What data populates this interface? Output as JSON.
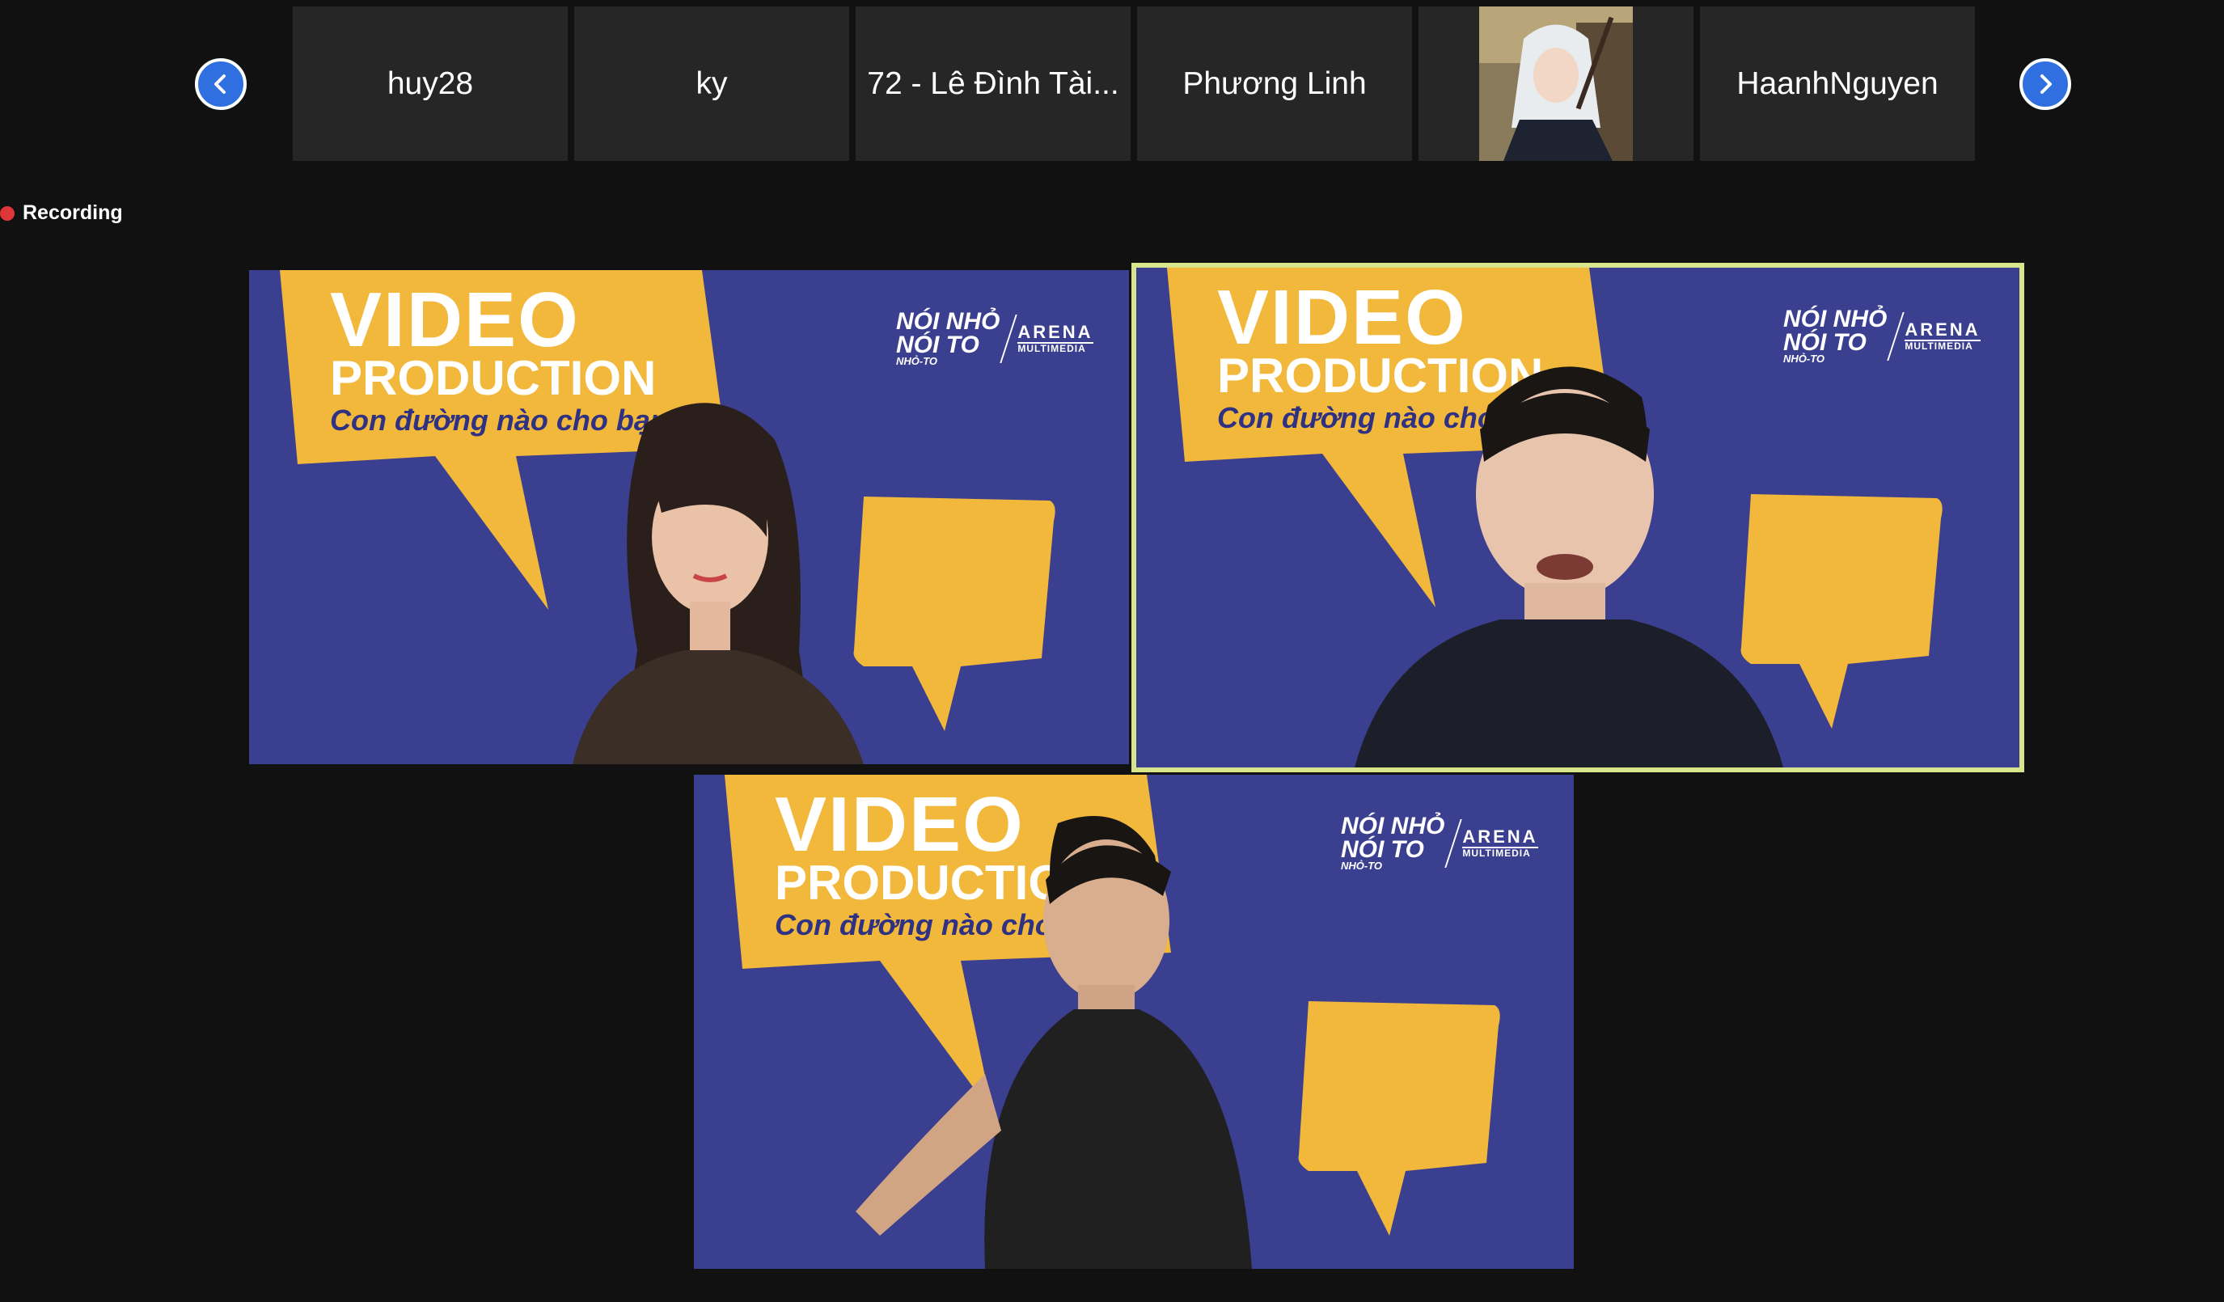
{
  "strip": {
    "prev_label": "previous participants",
    "next_label": "next participants",
    "participants": [
      {
        "name": "huy28"
      },
      {
        "name": "ky"
      },
      {
        "name": "72 - Lê Đình Tài..."
      },
      {
        "name": "Phương Linh"
      },
      {
        "name": ""
      },
      {
        "name": "HaanhNguyen"
      }
    ]
  },
  "recording": {
    "label": "Recording"
  },
  "banner": {
    "line1": "VIDEO",
    "line2": "PRODUCTION",
    "line3": "Con đường nào cho bạn?",
    "logo_noi_1": "NÓI NHỎ",
    "logo_noi_2": "NÓI TO",
    "logo_noi_3": "NHỎ-TO",
    "logo_arena": "ARENA",
    "logo_mm": "MULTIMEDIA"
  },
  "colors": {
    "background": "#111111",
    "thumb_bg": "#262626",
    "banner_blue": "#3b3f8f",
    "banner_yellow": "#f2b83b",
    "active_border": "#d9e58a",
    "nav_blue": "#2f6fe0",
    "recording_red": "#e0363a"
  }
}
